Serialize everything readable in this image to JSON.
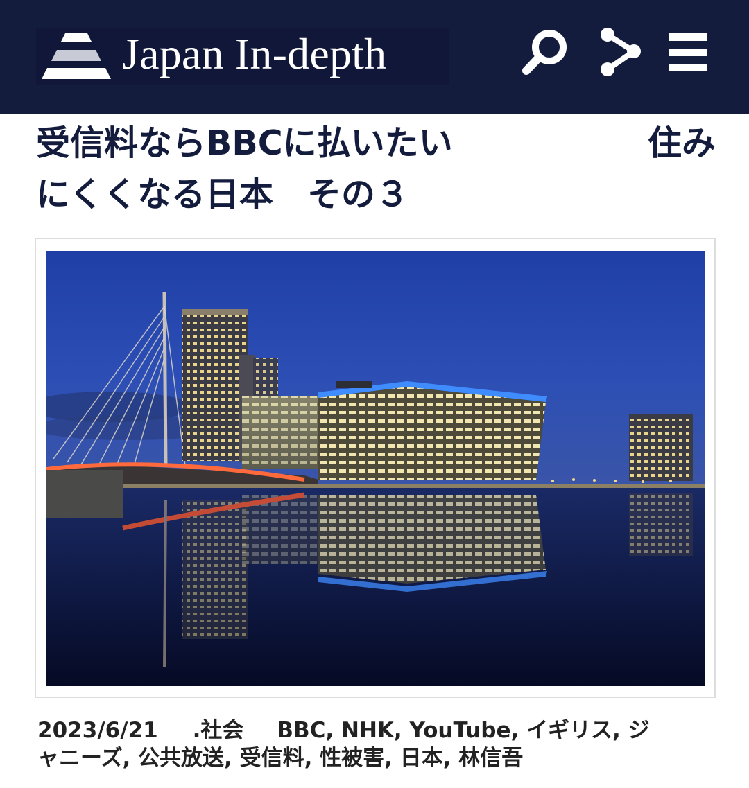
{
  "header": {
    "logo_text": "Japan In-depth",
    "icons": [
      "search-icon",
      "share-icon",
      "menu-icon"
    ],
    "background_color": "#141c3e",
    "icon_color": "#ffffff"
  },
  "article": {
    "title_line1_left": "受信料ならBBCに払いたい",
    "title_line1_right": "住み",
    "title_line2": "にくくなる日本　その３",
    "title_color": "#141c3e",
    "date": "2023/6/21",
    "category": ".社会",
    "tags_line1": "BBC, NHK, YouTube, イギリス, ジ",
    "tags_line2": "ャニーズ, 公共放送, 受信料, 性被害, 日本, 林信吾"
  }
}
